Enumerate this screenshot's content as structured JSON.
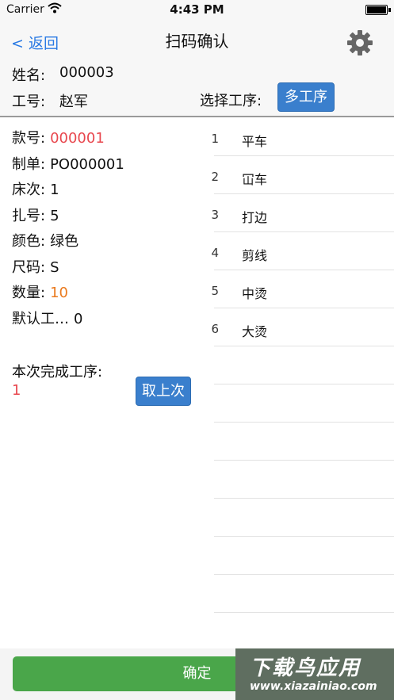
{
  "status": {
    "carrier": "Carrier",
    "time": "4:43 PM"
  },
  "nav": {
    "back": "< 返回",
    "title": "扫码确认"
  },
  "header": {
    "name_label": "姓名:",
    "name_value": "000003",
    "id_label": "工号:",
    "id_value": "赵军",
    "select_label": "选择工序:",
    "multi_button": "多工序"
  },
  "details": [
    {
      "label": "款号:",
      "value": "000001",
      "color": "#e8474e"
    },
    {
      "label": "制单:",
      "value": "PO000001"
    },
    {
      "label": "床次:",
      "value": "1"
    },
    {
      "label": "扎号:",
      "value": "5"
    },
    {
      "label": "颜色:",
      "value": "绿色"
    },
    {
      "label": "尺码:",
      "value": "S"
    },
    {
      "label": "数量:",
      "value": "10",
      "color": "#ea7a1e"
    },
    {
      "label": "默认工…",
      "value": "0"
    }
  ],
  "completed": {
    "label": "本次完成工序:",
    "value": "1",
    "undo_button": "取上次"
  },
  "processes": [
    {
      "num": "1",
      "name": "平车"
    },
    {
      "num": "2",
      "name": "冚车"
    },
    {
      "num": "3",
      "name": "打边"
    },
    {
      "num": "4",
      "name": "剪线"
    },
    {
      "num": "5",
      "name": "中烫"
    },
    {
      "num": "6",
      "name": "大烫"
    }
  ],
  "footer": {
    "confirm": "确定"
  },
  "watermark": {
    "line1": "下载鸟应用",
    "line2": "www.xiazainiao.com"
  }
}
